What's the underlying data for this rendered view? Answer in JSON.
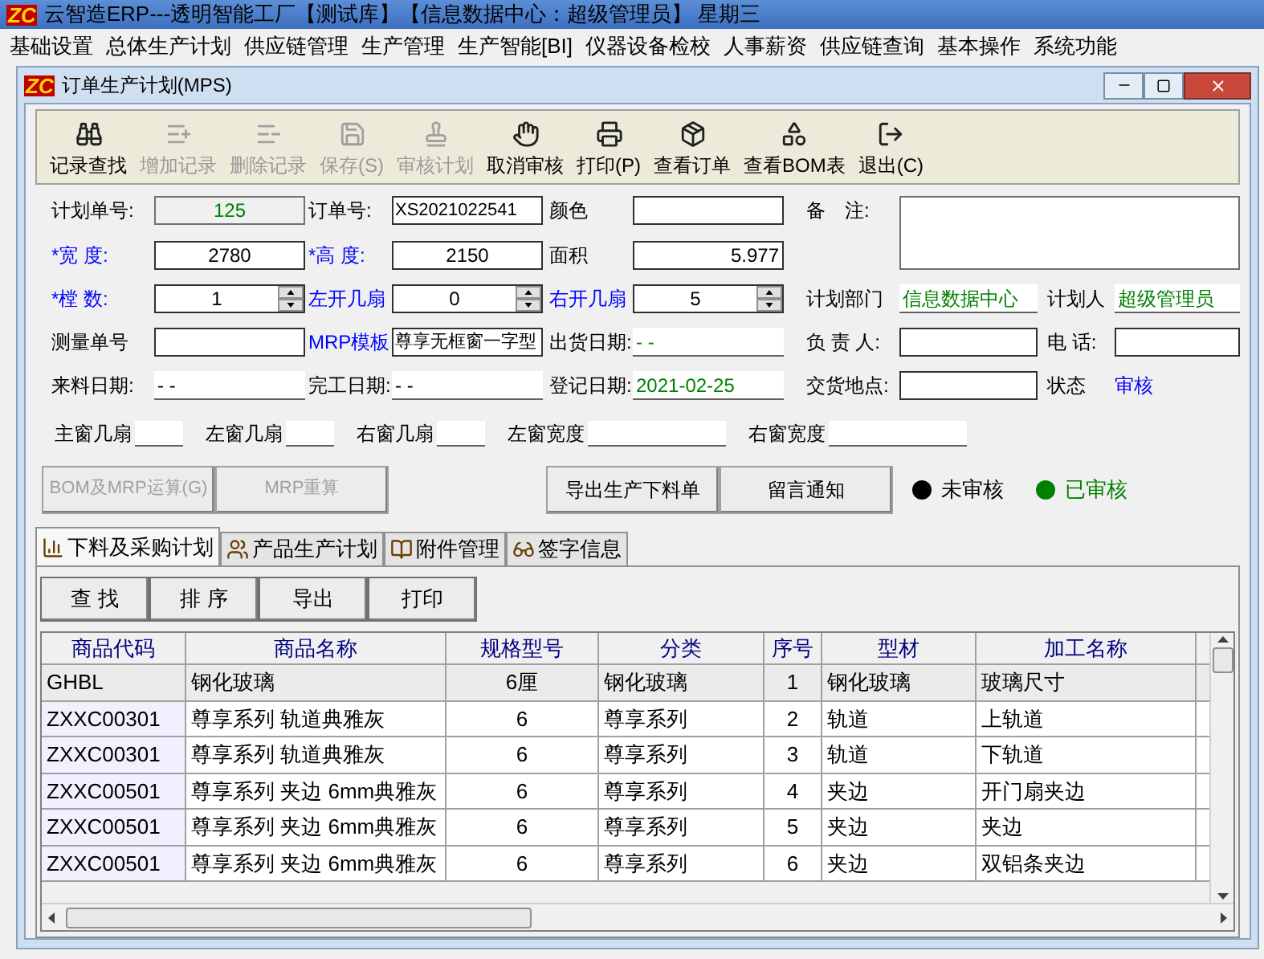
{
  "app_title": "云智造ERP---透明智能工厂【测试库】【信息数据中心：超级管理员】 星期三",
  "app_logo": "ZC",
  "menu": [
    "基础设置",
    "总体生产计划",
    "供应链管理",
    "生产管理",
    "生产智能[BI]",
    "仪器设备检校",
    "人事薪资",
    "供应链查询",
    "基本操作",
    "系统功能"
  ],
  "window": {
    "title": "订单生产计划(MPS)",
    "logo": "ZC"
  },
  "toolbar": [
    {
      "label": "记录查找",
      "disabled": false
    },
    {
      "label": "增加记录",
      "disabled": true
    },
    {
      "label": "删除记录",
      "disabled": true
    },
    {
      "label": "保存(S)",
      "disabled": true
    },
    {
      "label": "审核计划",
      "disabled": true
    },
    {
      "label": "取消审核",
      "disabled": false
    },
    {
      "label": "打印(P)",
      "disabled": false
    },
    {
      "label": "查看订单",
      "disabled": false
    },
    {
      "label": "查看BOM表",
      "disabled": false
    },
    {
      "label": "退出(C)",
      "disabled": false
    }
  ],
  "form_rows": [
    [
      {
        "label": {
          "text": "计划单号:"
        },
        "kind": "readonly",
        "value": {
          "text": "125",
          "color": "#008000"
        }
      },
      {
        "label": {
          "text": "订单号:"
        },
        "kind": "entry",
        "value": {
          "text": "XS2021022541"
        }
      },
      {
        "label": {
          "text": "颜色"
        },
        "kind": "box"
      },
      {
        "label": {
          "text": "备　注:"
        },
        "kind": "memo"
      }
    ],
    [
      {
        "label": {
          "text": "*宽 度:",
          "color": "#0000ff"
        },
        "kind": "box",
        "value": {
          "text": "2780"
        }
      },
      {
        "label": {
          "text": "*高 度:",
          "color": "#0000ff"
        },
        "kind": "box",
        "value": {
          "text": "2150"
        }
      },
      {
        "label": {
          "text": "面积"
        },
        "kind": "amount",
        "value": {
          "text": "5.977"
        }
      }
    ],
    [
      {
        "label": {
          "text": "*樘 数:",
          "color": "#0000ff"
        },
        "kind": "spin",
        "value": {
          "text": "1"
        }
      },
      {
        "label": {
          "text": "左开几扇",
          "color": "#0000ff"
        },
        "kind": "spin",
        "value": {
          "text": "0"
        }
      },
      {
        "label": {
          "text": "右开几扇",
          "color": "#0000ff"
        },
        "kind": "spin",
        "value": {
          "text": "5"
        }
      },
      {
        "label": {
          "text": "计划部门"
        },
        "kind": "line",
        "value": {
          "text": "信息数据中心",
          "color": "#008000"
        }
      },
      {
        "label": {
          "text": "计划人"
        },
        "kind": "line",
        "value": {
          "text": "超级管理员",
          "color": "#008000"
        }
      }
    ],
    [
      {
        "label": {
          "text": "测量单号"
        },
        "kind": "box"
      },
      {
        "label": {
          "text": "MRP模板",
          "color": "#0000ff"
        },
        "kind": "entry",
        "value": {
          "text": "尊享无框窗一字型"
        }
      },
      {
        "label": {
          "text": "出货日期:"
        },
        "kind": "line",
        "value": {
          "text": "- -",
          "color": "#008000"
        }
      },
      {
        "label": {
          "text": "负 责 人:"
        },
        "kind": "box"
      },
      {
        "label": {
          "text": "电 话:"
        },
        "kind": "box"
      }
    ],
    [
      {
        "label": {
          "text": "来料日期:"
        },
        "kind": "line",
        "value": {
          "text": "- -"
        }
      },
      {
        "label": {
          "text": "完工日期:"
        },
        "kind": "line",
        "value": {
          "text": "- -"
        }
      },
      {
        "label": {
          "text": "登记日期:"
        },
        "kind": "line",
        "value": {
          "text": "2021-02-25",
          "color": "#008000"
        }
      },
      {
        "label": {
          "text": "交货地点:"
        },
        "kind": "box"
      },
      {
        "label": {
          "text": "状态"
        },
        "kind": "text",
        "value": {
          "text": "审核",
          "color": "#0000ff"
        }
      }
    ]
  ],
  "sash_fields": [
    {
      "label": "主窗几扇",
      "kind": "short"
    },
    {
      "label": "左窗几扇",
      "kind": "short"
    },
    {
      "label": "右窗几扇",
      "kind": "short"
    },
    {
      "label": "左窗宽度",
      "kind": "long"
    },
    {
      "label": "右窗宽度",
      "kind": "long"
    }
  ],
  "actions_left": [
    {
      "label": "BOM及MRP运算(G)",
      "disabled": true
    },
    {
      "label": "MRP重算",
      "disabled": true
    }
  ],
  "actions_right": [
    {
      "label": "导出生产下料单",
      "disabled": false
    },
    {
      "label": "留言通知",
      "disabled": false
    }
  ],
  "legend": [
    {
      "label": "未审核",
      "color": "#000000"
    },
    {
      "label": "已审核",
      "color": "#008000"
    }
  ],
  "tabs": [
    {
      "label": "下料及采购计划",
      "selected": true
    },
    {
      "label": "产品生产计划",
      "selected": false
    },
    {
      "label": "附件管理",
      "selected": false
    },
    {
      "label": "签字信息",
      "selected": false
    }
  ],
  "tab_buttons": [
    "查 找",
    "排 序",
    "导出",
    "打印"
  ],
  "table": {
    "columns": [
      "商品代码",
      "商品名称",
      "规格型号",
      "分类",
      "序号",
      "型材",
      "加工名称"
    ],
    "rows": [
      {
        "selected": true,
        "cells": [
          "GHBL",
          "钢化玻璃",
          "6厘",
          "钢化玻璃",
          "1",
          "钢化玻璃",
          "玻璃尺寸"
        ]
      },
      {
        "selected": false,
        "cells": [
          "ZXXC00301",
          "尊享系列 轨道典雅灰",
          "6",
          "尊享系列",
          "2",
          "轨道",
          "上轨道"
        ]
      },
      {
        "selected": false,
        "cells": [
          "ZXXC00301",
          "尊享系列 轨道典雅灰",
          "6",
          "尊享系列",
          "3",
          "轨道",
          "下轨道"
        ]
      },
      {
        "selected": false,
        "cells": [
          "ZXXC00501",
          "尊享系列 夹边  6mm典雅灰",
          "6",
          "尊享系列",
          "4",
          "夹边",
          "开门扇夹边"
        ]
      },
      {
        "selected": false,
        "cells": [
          "ZXXC00501",
          "尊享系列 夹边  6mm典雅灰",
          "6",
          "尊享系列",
          "5",
          "夹边",
          "夹边"
        ]
      },
      {
        "selected": false,
        "cells": [
          "ZXXC00501",
          "尊享系列 夹边  6mm典雅灰",
          "6",
          "尊享系列",
          "6",
          "夹边",
          "双铝条夹边"
        ]
      }
    ]
  }
}
